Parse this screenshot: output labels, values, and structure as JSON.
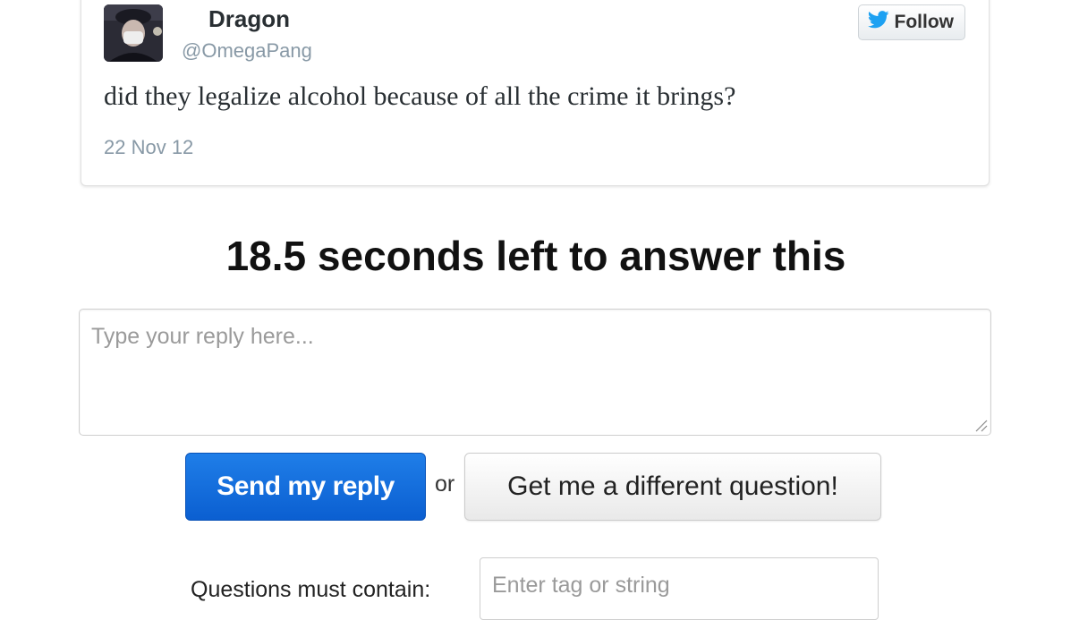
{
  "tweet": {
    "author_name": "Dragon",
    "author_handle": "@OmegaPang",
    "follow_label": "Follow",
    "text": "did they legalize alcohol because of all the crime it brings?",
    "date": "22 Nov 12"
  },
  "countdown": {
    "text": "18.5 seconds left to answer this"
  },
  "reply": {
    "placeholder": "Type your reply here..."
  },
  "actions": {
    "send_label": "Send my reply",
    "or_label": "or",
    "different_label": "Get me a different question!"
  },
  "filter": {
    "label": "Questions must contain:",
    "placeholder": "Enter tag or string"
  },
  "colors": {
    "send_button": "#0b5fd1",
    "twitter_blue": "#1da1f2"
  },
  "icons": {
    "follow": "twitter-bird-icon",
    "resize": "resize-grip-icon"
  }
}
